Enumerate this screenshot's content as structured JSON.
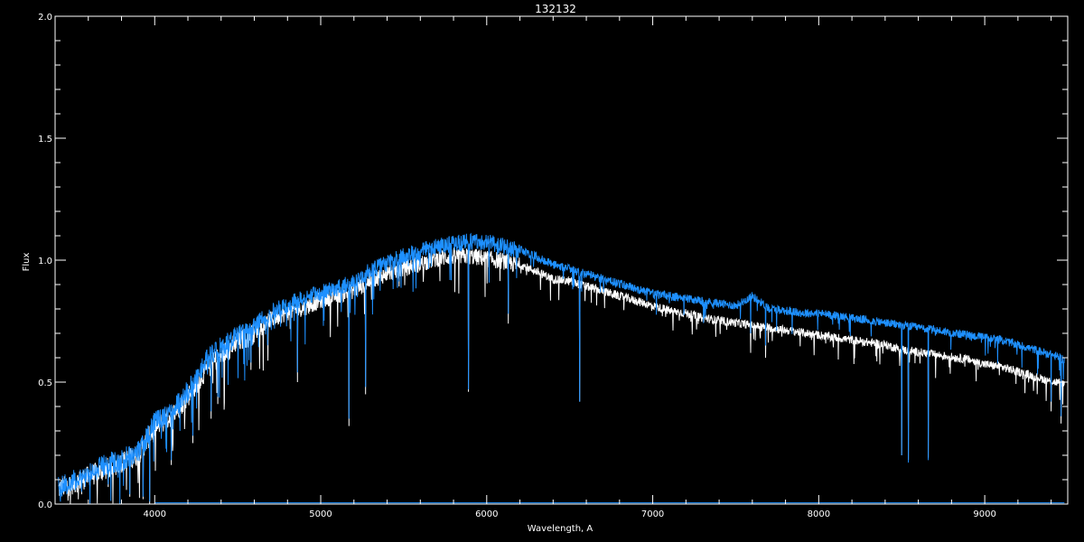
{
  "chart_data": {
    "type": "line",
    "title": "132132",
    "xlabel": "Wavelength, A",
    "ylabel": "Flux",
    "xlim": [
      3400,
      9500
    ],
    "ylim": [
      0.0,
      2.0
    ],
    "x_ticks": [
      4000,
      5000,
      6000,
      7000,
      8000,
      9000
    ],
    "x_tick_labels": [
      "4000",
      "5000",
      "6000",
      "7000",
      "8000",
      "9000"
    ],
    "y_ticks": [
      0.0,
      0.5,
      1.0,
      1.5,
      2.0
    ],
    "y_tick_labels": [
      "0.0",
      "0.5",
      "1.0",
      "1.5",
      "2.0"
    ],
    "grid": false,
    "background": "#000000",
    "axis_color": "#ffffff",
    "series": [
      {
        "color": "#ffffff",
        "x": [
          3420,
          3500,
          3600,
          3700,
          3800,
          3900,
          4000,
          4100,
          4200,
          4300,
          4400,
          4500,
          4600,
          4700,
          4800,
          4900,
          5000,
          5100,
          5200,
          5300,
          5400,
          5500,
          5600,
          5700,
          5800,
          5900,
          6000,
          6100,
          6200,
          6300,
          6400,
          6500,
          6600,
          6700,
          6800,
          6900,
          7000,
          7100,
          7200,
          7300,
          7400,
          7500,
          7600,
          7700,
          7800,
          7900,
          8000,
          8100,
          8200,
          8300,
          8400,
          8500,
          8600,
          8700,
          8800,
          8900,
          9000,
          9100,
          9200,
          9300,
          9400,
          9480
        ],
        "y": [
          0.08,
          0.1,
          0.13,
          0.16,
          0.19,
          0.22,
          0.33,
          0.38,
          0.46,
          0.56,
          0.63,
          0.68,
          0.72,
          0.77,
          0.8,
          0.82,
          0.85,
          0.87,
          0.89,
          0.93,
          0.96,
          0.98,
          1.0,
          1.02,
          1.03,
          1.03,
          1.02,
          1.01,
          0.99,
          0.96,
          0.93,
          0.92,
          0.9,
          0.88,
          0.86,
          0.84,
          0.82,
          0.8,
          0.79,
          0.77,
          0.76,
          0.75,
          0.74,
          0.73,
          0.72,
          0.71,
          0.7,
          0.69,
          0.68,
          0.67,
          0.66,
          0.64,
          0.63,
          0.62,
          0.61,
          0.6,
          0.58,
          0.57,
          0.55,
          0.53,
          0.51,
          0.5
        ],
        "dips": [
          [
            3480,
            0.05
          ],
          [
            3560,
            0.04
          ],
          [
            3720,
            0.07
          ],
          [
            3850,
            0.03
          ],
          [
            3930,
            0.02
          ],
          [
            3970,
            0.0
          ],
          [
            4100,
            0.16
          ],
          [
            4230,
            0.25
          ],
          [
            4340,
            0.35
          ],
          [
            4380,
            0.41
          ],
          [
            4580,
            0.55
          ],
          [
            4860,
            0.5
          ],
          [
            5170,
            0.32
          ],
          [
            5270,
            0.45
          ],
          [
            5890,
            0.46
          ],
          [
            6130,
            0.74
          ],
          [
            6560,
            0.42
          ],
          [
            7590,
            0.62
          ],
          [
            7680,
            0.6
          ],
          [
            8500,
            0.2
          ],
          [
            8540,
            0.18
          ],
          [
            8660,
            0.19
          ],
          [
            9400,
            0.38
          ],
          [
            9460,
            0.33
          ]
        ]
      },
      {
        "color": "#1e90ff",
        "x": [
          3420,
          3500,
          3600,
          3700,
          3800,
          3900,
          4000,
          4100,
          4200,
          4300,
          4400,
          4500,
          4600,
          4700,
          4800,
          4900,
          5000,
          5100,
          5200,
          5300,
          5400,
          5500,
          5600,
          5700,
          5800,
          5900,
          6000,
          6100,
          6200,
          6300,
          6400,
          6500,
          6600,
          6700,
          6800,
          6900,
          7000,
          7100,
          7200,
          7300,
          7400,
          7500,
          7600,
          7700,
          7800,
          7900,
          8000,
          8100,
          8200,
          8300,
          8400,
          8500,
          8600,
          8700,
          8800,
          8900,
          9000,
          9100,
          9200,
          9300,
          9400,
          9480
        ],
        "y": [
          0.09,
          0.11,
          0.14,
          0.18,
          0.2,
          0.23,
          0.35,
          0.4,
          0.48,
          0.6,
          0.66,
          0.71,
          0.75,
          0.8,
          0.83,
          0.86,
          0.88,
          0.9,
          0.93,
          0.97,
          1.0,
          1.03,
          1.05,
          1.07,
          1.08,
          1.09,
          1.09,
          1.07,
          1.05,
          1.02,
          0.99,
          0.97,
          0.95,
          0.93,
          0.91,
          0.89,
          0.87,
          0.86,
          0.85,
          0.84,
          0.83,
          0.82,
          0.86,
          0.81,
          0.8,
          0.79,
          0.79,
          0.78,
          0.77,
          0.76,
          0.75,
          0.74,
          0.73,
          0.72,
          0.71,
          0.7,
          0.69,
          0.68,
          0.66,
          0.64,
          0.62,
          0.6
        ],
        "dips": [
          [
            3480,
            0.06
          ],
          [
            3560,
            0.05
          ],
          [
            3720,
            0.08
          ],
          [
            3850,
            0.04
          ],
          [
            3930,
            0.03
          ],
          [
            3970,
            0.01
          ],
          [
            4100,
            0.18
          ],
          [
            4230,
            0.28
          ],
          [
            4340,
            0.38
          ],
          [
            4380,
            0.44
          ],
          [
            4580,
            0.58
          ],
          [
            4860,
            0.54
          ],
          [
            5170,
            0.35
          ],
          [
            5270,
            0.48
          ],
          [
            5890,
            0.47
          ],
          [
            6130,
            0.78
          ],
          [
            6560,
            0.42
          ],
          [
            7590,
            0.7
          ],
          [
            7680,
            0.65
          ],
          [
            8500,
            0.2
          ],
          [
            8540,
            0.17
          ],
          [
            8660,
            0.18
          ],
          [
            9400,
            0.42
          ],
          [
            9460,
            0.36
          ]
        ]
      }
    ]
  }
}
